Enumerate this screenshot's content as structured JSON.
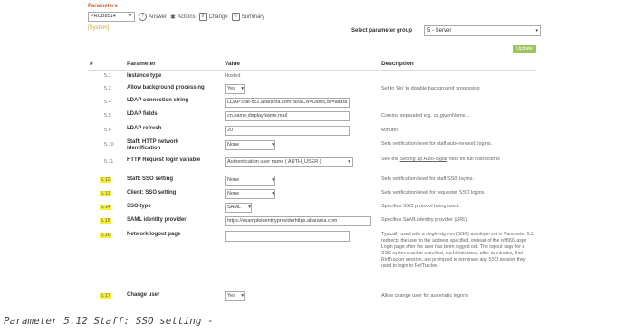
{
  "header": {
    "section_title": "Parameters",
    "record_select": "PROB8514",
    "actions": [
      {
        "label": "Answer",
        "icon": "answer-icon"
      },
      {
        "label": "Actions",
        "icon": "actions-icon"
      },
      {
        "label": "Change",
        "icon": "change-icon"
      },
      {
        "label": "Summary",
        "icon": "summary-icon"
      }
    ],
    "system_tag": "[System]",
    "group_label": "Select parameter group",
    "group_value": "5 - Server",
    "update_label": "Update"
  },
  "table": {
    "columns": [
      "#",
      "Parameter",
      "Value",
      "Description"
    ],
    "rows": [
      {
        "num": "5.1",
        "name": "Instance type",
        "value": "Hosted",
        "desc": ""
      },
      {
        "num": "5.2",
        "name": "Allow background processing",
        "value": "Yes",
        "desc": "Set to 'No' to disable background processing"
      },
      {
        "num": "5.4",
        "name": "LDAP connection string",
        "value": "LDAP://alt-dc2.altarama.com:389/CN=Users,dc=altara",
        "desc": ""
      },
      {
        "num": "5.5",
        "name": "LDAP fields",
        "value": "cn,name,displayName,mail",
        "desc": "Comma separated e.g. cn,givenName..."
      },
      {
        "num": "5.6",
        "name": "LDAP refresh",
        "value": "20",
        "desc": "Minutes"
      },
      {
        "num": "5.10",
        "name": "Staff: HTTP network identification",
        "value": "None",
        "desc": "Sets verification level for staff auto-network logins."
      },
      {
        "num": "5.11",
        "name": "HTTP Request login variable",
        "value": "Authentication user name ( AUTH_USER )",
        "desc_pre": "See the ",
        "desc_link": "Setting up Auto-logon",
        "desc_post": " help for full instructions"
      },
      {
        "num": "5.12",
        "name": "Staff: SSO setting",
        "value": "None",
        "desc": "Sets verification level for staff SSO logins."
      },
      {
        "num": "5.13",
        "name": "Client: SSO setting",
        "value": "None",
        "desc": "Sets verification level for requester SSO logins."
      },
      {
        "num": "5.14",
        "name": "SSO type",
        "value": "SAML",
        "desc": "Specifies SSO protocol being used."
      },
      {
        "num": "5.15",
        "name": "SAML identity provider",
        "value": "https://exampleidentityproviderhttps.altarama.com",
        "desc": "Specifies SAML identity provider (URL)."
      },
      {
        "num": "5.16",
        "name": "Network logout page",
        "value": "",
        "desc": "Typically used with a single-sign-on (SSO) autologin set in Parameter 5.3, redirects the user to the address specified, instead of the reft996.aspx Login page after the user has been logged out. The logout page for a SSO system can be specified, such that users, after terminating their RefTracker session, are prompted to terminate any SSO session they used to login to RefTracker."
      },
      {
        "num": "5.17",
        "name": "Change user",
        "value": "Yes",
        "desc": "Allow change user for automatic logons"
      }
    ]
  },
  "caption": "Parameter 5.12  Staff: SSO setting -"
}
